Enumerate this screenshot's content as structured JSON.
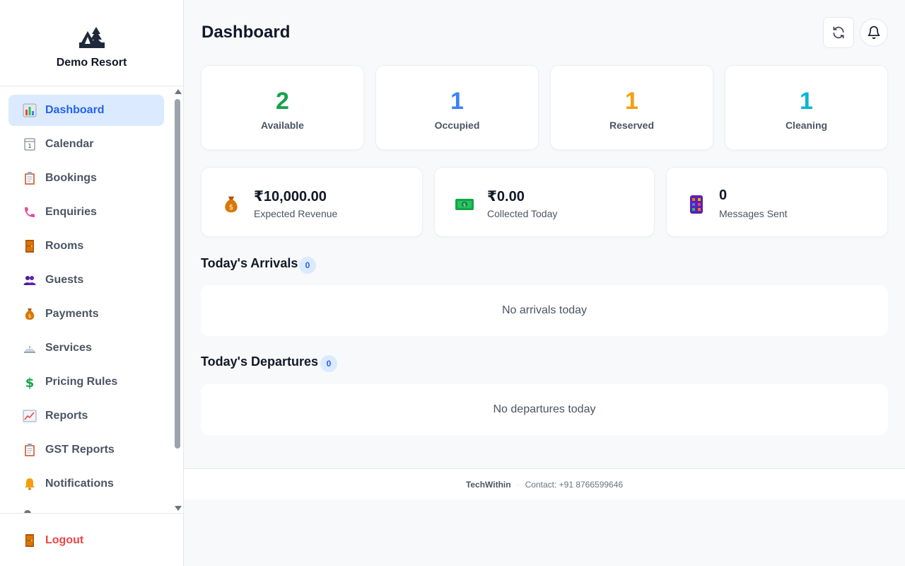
{
  "brand": {
    "name": "Demo Resort",
    "logo_icon": "tent-trees-icon"
  },
  "sidebar": {
    "items": [
      {
        "label": "Dashboard",
        "icon": "bar-chart-icon",
        "active": true
      },
      {
        "label": "Calendar",
        "icon": "calendar-icon"
      },
      {
        "label": "Bookings",
        "icon": "clipboard-icon"
      },
      {
        "label": "Enquiries",
        "icon": "phone-icon"
      },
      {
        "label": "Rooms",
        "icon": "door-icon"
      },
      {
        "label": "Guests",
        "icon": "people-icon"
      },
      {
        "label": "Payments",
        "icon": "money-bag-icon"
      },
      {
        "label": "Services",
        "icon": "bellhop-icon"
      },
      {
        "label": "Pricing Rules",
        "icon": "dollar-sign-icon"
      },
      {
        "label": "Reports",
        "icon": "trend-chart-icon"
      },
      {
        "label": "GST Reports",
        "icon": "clipboard-icon"
      },
      {
        "label": "Notifications",
        "icon": "bell-icon"
      }
    ],
    "logout_label": "Logout"
  },
  "header": {
    "title": "Dashboard"
  },
  "room_stats": [
    {
      "value": "2",
      "label": "Available",
      "color": "#16a34a"
    },
    {
      "value": "1",
      "label": "Occupied",
      "color": "#3b82f6"
    },
    {
      "value": "1",
      "label": "Reserved",
      "color": "#f59e0b"
    },
    {
      "value": "1",
      "label": "Cleaning",
      "color": "#06b6d4"
    }
  ],
  "money_stats": [
    {
      "value": "₹10,000.00",
      "label": "Expected Revenue",
      "icon": "money-bag-icon"
    },
    {
      "value": "₹0.00",
      "label": "Collected Today",
      "icon": "banknote-icon"
    },
    {
      "value": "0",
      "label": "Messages Sent",
      "icon": "phone-grid-icon"
    }
  ],
  "arrivals": {
    "title": "Today's Arrivals",
    "count": "0",
    "empty": "No arrivals today"
  },
  "departures": {
    "title": "Today's Departures",
    "count": "0",
    "empty": "No departures today"
  },
  "footer": {
    "company": "TechWithin",
    "separator": "·",
    "contact": "Contact: +91 8766599646"
  }
}
